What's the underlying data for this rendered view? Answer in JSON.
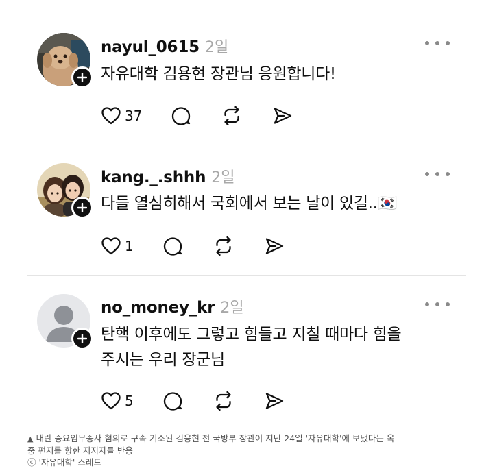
{
  "posts": [
    {
      "username": "nayul_0615",
      "time": "2일",
      "text": "자유대학 김용현 장관님 응원합니다!",
      "like_count": "37"
    },
    {
      "username": "kang._.shhh",
      "time": "2일",
      "text": "다들 열심히해서 국회에서 보는 날이 있길..🇰🇷",
      "like_count": "1"
    },
    {
      "username": "no_money_kr",
      "time": "2일",
      "text_line1": "탄핵 이후에도 그렇고 힘들고 지칠 때마다 힘을",
      "text_line2": "주시는 우리 장군님",
      "like_count": "5"
    }
  ],
  "caption": {
    "marker": "▲",
    "line1": "내란 중요임무종사 혐의로 구속 기소된 김용현 전 국방부 장관이 지난 24일 '자유대학'에 보냈다는 옥",
    "line2": "중 편지를 향한 지지자들 반응",
    "credit": "ⓒ '자유대학' 스레드"
  },
  "icons": {
    "like": "heart-icon",
    "comment": "comment-bubble-icon",
    "repost": "repost-icon",
    "share": "send-icon",
    "more": "more-dots-icon",
    "follow": "plus-icon"
  },
  "colors": {
    "text": "#101010",
    "secondary": "#a8a8a8",
    "divider": "#e4e4e4"
  }
}
